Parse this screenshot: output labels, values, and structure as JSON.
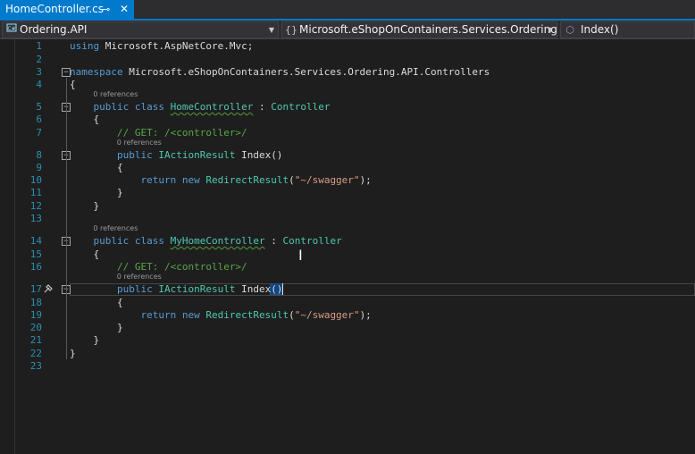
{
  "tab": {
    "title": "HomeController.cs",
    "pin_icon": "⊸",
    "close_icon": "✕"
  },
  "navbar": {
    "project": {
      "label": "Ordering.API",
      "icon": "project-icon"
    },
    "namespace": {
      "label": "Microsoft.eShopOnContainers.Services.Ordering.AP",
      "icon": "namespace-icon"
    },
    "member": {
      "label": "Index()",
      "icon": "method-icon"
    }
  },
  "lens": {
    "references": "0 references"
  },
  "colors": {
    "accent": "#007acc",
    "keyword": "#569cd6",
    "type": "#4ec9b0",
    "comment": "#57a64a",
    "string": "#d69d85",
    "line_number": "#2b91af"
  },
  "lines": [
    {
      "n": "1",
      "tokens": [
        [
          "kw",
          "using"
        ],
        [
          "tx",
          " Microsoft.AspNetCore.Mvc;"
        ]
      ]
    },
    {
      "n": "2",
      "tokens": []
    },
    {
      "n": "3",
      "tokens": [
        [
          "kw",
          "namespace"
        ],
        [
          "tx",
          " Microsoft.eShopOnContainers.Services.Ordering.API.Controllers"
        ]
      ]
    },
    {
      "n": "4",
      "tokens": [
        [
          "tx",
          "{"
        ]
      ]
    },
    {
      "n": "5",
      "tokens": [
        [
          "tx",
          "    "
        ],
        [
          "kw",
          "public"
        ],
        [
          "tx",
          " "
        ],
        [
          "kw",
          "class"
        ],
        [
          "tx",
          " "
        ],
        [
          "ty",
          "HomeController"
        ],
        [
          "tx",
          " : "
        ],
        [
          "ty",
          "Controller"
        ]
      ]
    },
    {
      "n": "6",
      "tokens": [
        [
          "tx",
          "    {"
        ]
      ]
    },
    {
      "n": "7",
      "tokens": [
        [
          "tx",
          "        "
        ],
        [
          "cm",
          "// GET: /<controller>/"
        ]
      ]
    },
    {
      "n": "8",
      "tokens": [
        [
          "tx",
          "        "
        ],
        [
          "kw",
          "public"
        ],
        [
          "tx",
          " "
        ],
        [
          "ty",
          "IActionResult"
        ],
        [
          "tx",
          " Index()"
        ]
      ]
    },
    {
      "n": "9",
      "tokens": [
        [
          "tx",
          "        {"
        ]
      ]
    },
    {
      "n": "10",
      "tokens": [
        [
          "tx",
          "            "
        ],
        [
          "kw",
          "return"
        ],
        [
          "tx",
          " "
        ],
        [
          "kw",
          "new"
        ],
        [
          "tx",
          " "
        ],
        [
          "ty",
          "RedirectResult"
        ],
        [
          "tx",
          "("
        ],
        [
          "st",
          "\"~/swagger\""
        ],
        [
          "tx",
          ");"
        ]
      ]
    },
    {
      "n": "11",
      "tokens": [
        [
          "tx",
          "        }"
        ]
      ]
    },
    {
      "n": "12",
      "tokens": [
        [
          "tx",
          "    }"
        ]
      ]
    },
    {
      "n": "13",
      "tokens": []
    },
    {
      "n": "14",
      "tokens": [
        [
          "tx",
          "    "
        ],
        [
          "kw",
          "public"
        ],
        [
          "tx",
          " "
        ],
        [
          "kw",
          "class"
        ],
        [
          "tx",
          " "
        ],
        [
          "ty",
          "MyHomeController"
        ],
        [
          "tx",
          " : "
        ],
        [
          "ty",
          "Controller"
        ]
      ]
    },
    {
      "n": "15",
      "tokens": [
        [
          "tx",
          "    {"
        ]
      ]
    },
    {
      "n": "16",
      "tokens": [
        [
          "tx",
          "        "
        ],
        [
          "cm",
          "// GET: /<controller>/"
        ]
      ]
    },
    {
      "n": "17",
      "tokens": [
        [
          "tx",
          "        "
        ],
        [
          "kw",
          "public"
        ],
        [
          "tx",
          " "
        ],
        [
          "ty",
          "IActionResult"
        ],
        [
          "tx",
          " Index()"
        ]
      ]
    },
    {
      "n": "18",
      "tokens": [
        [
          "tx",
          "        {"
        ]
      ]
    },
    {
      "n": "19",
      "tokens": [
        [
          "tx",
          "            "
        ],
        [
          "kw",
          "return"
        ],
        [
          "tx",
          " "
        ],
        [
          "kw",
          "new"
        ],
        [
          "tx",
          " "
        ],
        [
          "ty",
          "RedirectResult"
        ],
        [
          "tx",
          "("
        ],
        [
          "st",
          "\"~/swagger\""
        ],
        [
          "tx",
          ");"
        ]
      ]
    },
    {
      "n": "20",
      "tokens": [
        [
          "tx",
          "        }"
        ]
      ]
    },
    {
      "n": "21",
      "tokens": [
        [
          "tx",
          "    }"
        ]
      ]
    },
    {
      "n": "22",
      "tokens": [
        [
          "tx",
          "}"
        ]
      ]
    },
    {
      "n": "23",
      "tokens": []
    }
  ]
}
